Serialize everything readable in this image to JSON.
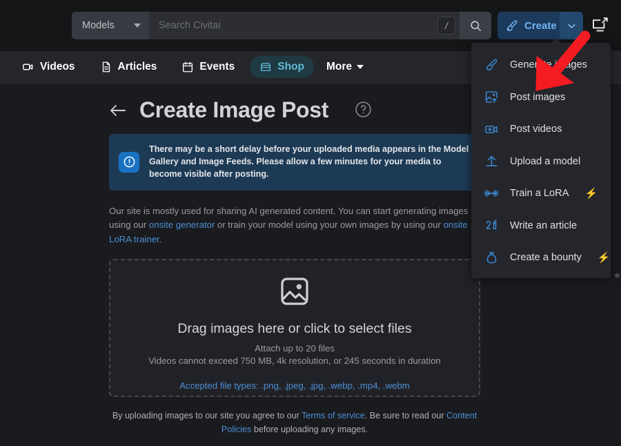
{
  "topbar": {
    "models_dropdown_label": "Models",
    "search_placeholder": "Search Civitai",
    "search_value": "",
    "slash_shortcut": "/",
    "create_label": "Create",
    "icons": {
      "search": "search-icon",
      "brush": "brush-icon",
      "chevron": "chevron-down-icon",
      "cast": "screen-share-icon"
    }
  },
  "nav": {
    "items": [
      {
        "label": "Videos",
        "icon": "video-icon",
        "active": false
      },
      {
        "label": "Articles",
        "icon": "document-icon",
        "active": false
      },
      {
        "label": "Events",
        "icon": "calendar-icon",
        "active": false
      },
      {
        "label": "Shop",
        "icon": "shop-icon",
        "active": true
      }
    ],
    "more_label": "More"
  },
  "create_menu": {
    "items": [
      {
        "label": "Generate images",
        "icon": "brush-icon",
        "badge": ""
      },
      {
        "label": "Post images",
        "icon": "image-upload-icon",
        "badge": ""
      },
      {
        "label": "Post videos",
        "icon": "video-plus-icon",
        "badge": ""
      },
      {
        "label": "Upload a model",
        "icon": "upload-arrow-icon",
        "badge": ""
      },
      {
        "label": "Train a LoRA",
        "icon": "dumbbell-icon",
        "badge": "⚡"
      },
      {
        "label": "Write an article",
        "icon": "pen-article-icon",
        "badge": ""
      },
      {
        "label": "Create a bounty",
        "icon": "money-bag-icon",
        "badge": "⚡"
      }
    ]
  },
  "main": {
    "back_icon": "back-arrow-icon",
    "title": "Create Image Post",
    "help_icon": "help-circle-icon",
    "alert": {
      "icon": "alert-exclamation-icon",
      "text": "There may be a short delay before your uploaded media appears in the Model Gallery and Image Feeds. Please allow a few minutes for your media to become visible after posting."
    },
    "blurb": {
      "part1": "Our site is mostly used for sharing AI generated content. You can start generating images using our ",
      "link1": "onsite generator",
      "part2": " or train your model using your own images by using our ",
      "link2": "onsite LoRA trainer",
      "part3": "."
    },
    "dropzone": {
      "icon": "image-placeholder-icon",
      "title": "Drag images here or click to select files",
      "sub1": "Attach up to 20 files",
      "sub2": "Videos cannot exceed 750 MB, 4k resolution, or 245 seconds in duration",
      "accepted": "Accepted file types: .png, .jpeg, .jpg, .webp, .mp4, .webm"
    },
    "terms": {
      "part1": "By uploading images to our site you agree to our ",
      "link1": "Terms of service",
      "part2": ". Be sure to read our ",
      "link2": "Content Policies",
      "part3": " before uploading any images."
    }
  },
  "annotation": {
    "type": "red-arrow",
    "color": "#f51b22",
    "points_to": "Post images"
  },
  "colors": {
    "page_bg": "#1a1b1e",
    "topbar_bg": "#141517",
    "navbar_bg": "#25262b",
    "accent_blue": "#4d8fd6",
    "create_blue": "#74b3f0",
    "alert_bg": "#1d3a55",
    "shop_active": "#63b8d6"
  }
}
